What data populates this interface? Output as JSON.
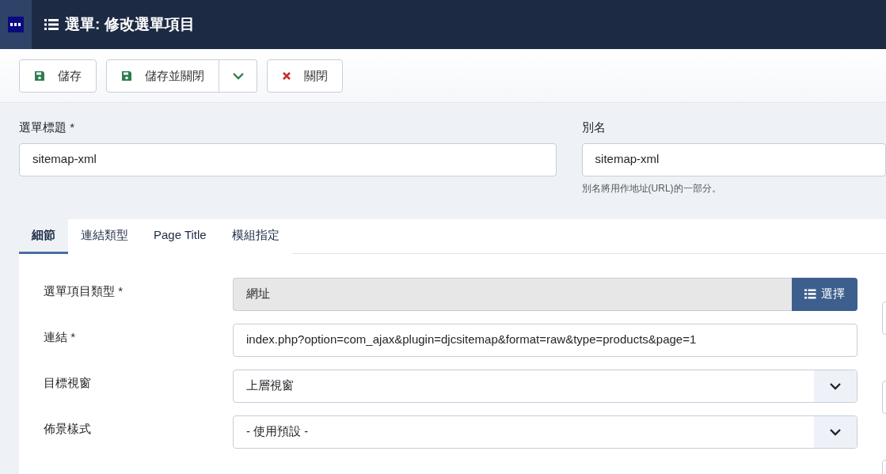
{
  "header": {
    "title": "選單: 修改選單項目"
  },
  "toolbar": {
    "buttons": [
      {
        "label": "儲存",
        "kind": "save"
      },
      {
        "label": "儲存並關閉",
        "kind": "save-dropdown"
      },
      {
        "label": "關閉",
        "kind": "close"
      }
    ]
  },
  "title_field": {
    "label": "選單標題 *",
    "value": "sitemap-xml"
  },
  "alias_field": {
    "label": "別名",
    "value": "sitemap-xml",
    "help": "別名將用作地址(URL)的一部分。"
  },
  "tabs": [
    {
      "label": "細節",
      "selected": true
    },
    {
      "label": "連結類型",
      "selected": false
    },
    {
      "label": "Page Title",
      "selected": false
    },
    {
      "label": "模組指定",
      "selected": false
    }
  ],
  "fields": [
    {
      "label": "選單項目類型 *",
      "kind": "readonly",
      "value": "網址",
      "button": "選擇"
    },
    {
      "label": "連結 *",
      "kind": "text",
      "value": "index.php?option=com_ajax&plugin=djcsitemap&format=raw&type=products&page=1"
    },
    {
      "label": "目標視窗",
      "kind": "select",
      "value": "上層視窗"
    },
    {
      "label": "佈景樣式",
      "kind": "select",
      "value": "- 使用預設 -"
    }
  ]
}
